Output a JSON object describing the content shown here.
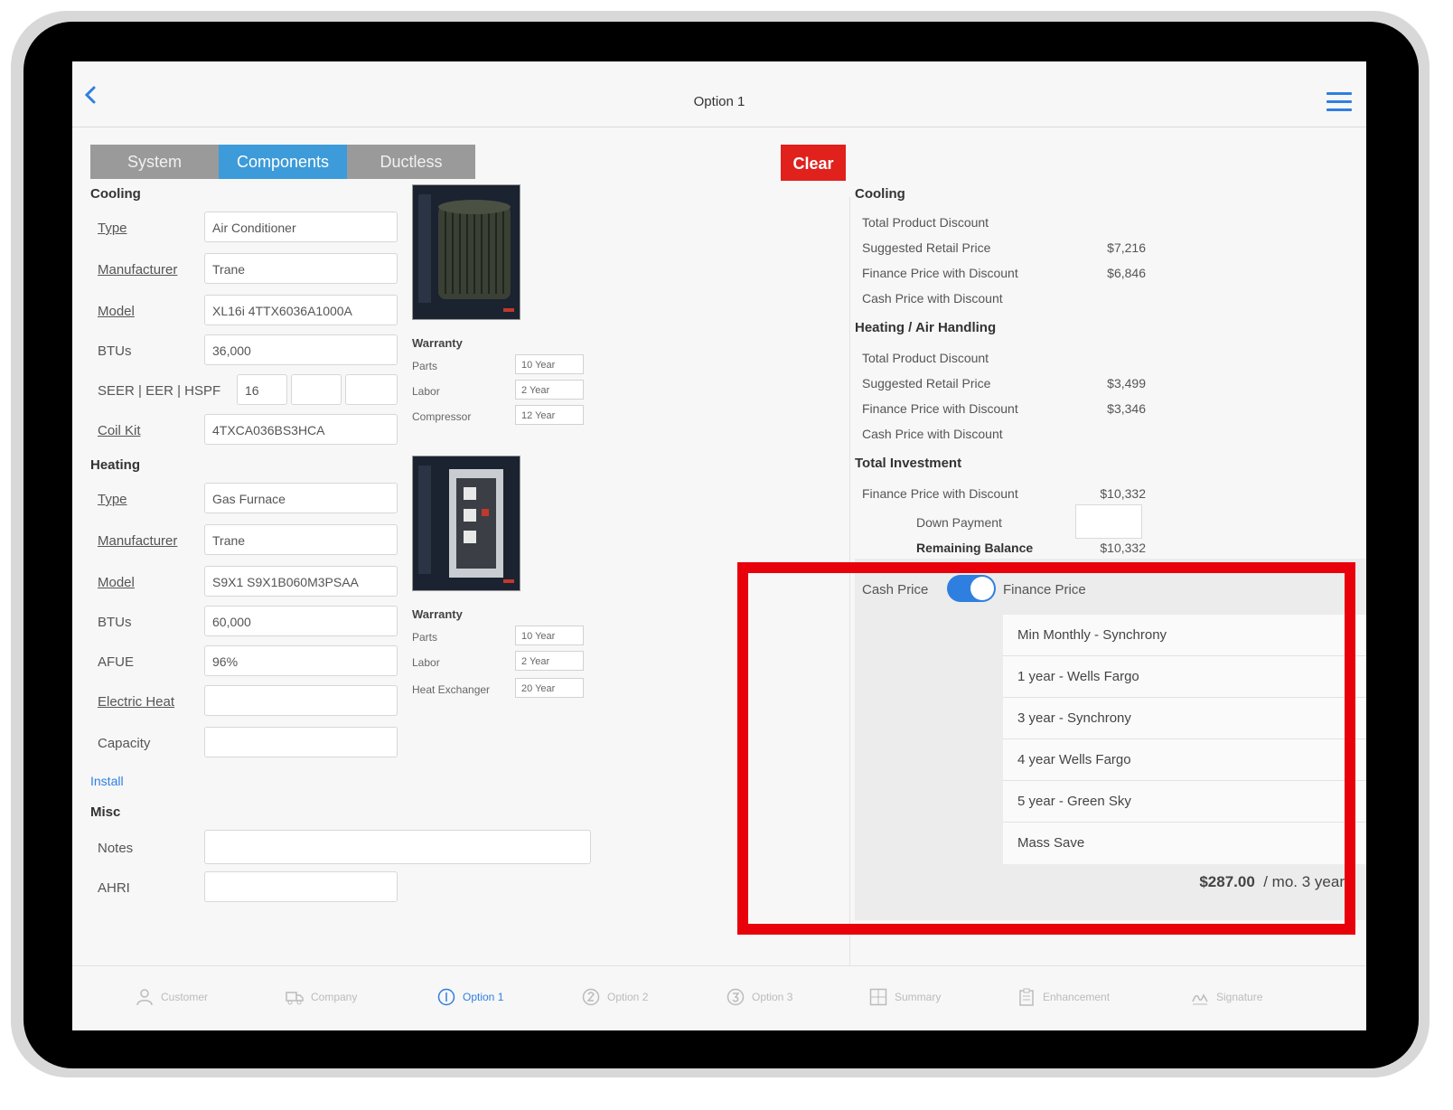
{
  "nav": {
    "title": "Option 1"
  },
  "segments": [
    {
      "label": "System",
      "active": false
    },
    {
      "label": "Components",
      "active": true
    },
    {
      "label": "Ductless",
      "active": false
    }
  ],
  "clear_label": "Clear",
  "cooling": {
    "heading": "Cooling",
    "type_label": "Type",
    "type_value": "Air Conditioner",
    "manufacturer_label": "Manufacturer",
    "manufacturer_value": "Trane",
    "model_label": "Model",
    "model_value": "XL16i 4TTX6036A1000A",
    "btus_label": "BTUs",
    "btus_value": "36,000",
    "seer_label": "SEER | EER | HSPF",
    "seer_value": "16",
    "eer_value": "",
    "hspf_value": "",
    "coil_label": "Coil Kit",
    "coil_value": "4TXCA036BS3HCA"
  },
  "heating": {
    "heading": "Heating",
    "type_label": "Type",
    "type_value": "Gas Furnace",
    "manufacturer_label": "Manufacturer",
    "manufacturer_value": "Trane",
    "model_label": "Model",
    "model_value": "S9X1 S9X1B060M3PSAA",
    "btus_label": "BTUs",
    "btus_value": "60,000",
    "afue_label": "AFUE",
    "afue_value": "96%",
    "electric_label": "Electric Heat",
    "electric_value": "",
    "capacity_label": "Capacity",
    "capacity_value": ""
  },
  "install_link": "Install",
  "misc": {
    "heading": "Misc",
    "notes_label": "Notes",
    "notes_value": "",
    "ahri_label": "AHRI",
    "ahri_value": ""
  },
  "cooling_warranty": {
    "heading": "Warranty",
    "rows": [
      {
        "label": "Parts",
        "value": "10 Year"
      },
      {
        "label": "Labor",
        "value": "2 Year"
      },
      {
        "label": "Compressor",
        "value": "12 Year"
      }
    ]
  },
  "heating_warranty": {
    "heading": "Warranty",
    "rows": [
      {
        "label": "Parts",
        "value": "10 Year"
      },
      {
        "label": "Labor",
        "value": "2 Year"
      },
      {
        "label": "Heat Exchanger",
        "value": "20 Year"
      }
    ]
  },
  "summary": {
    "cooling_heading": "Cooling",
    "cooling_rows": [
      {
        "label": "Total Product Discount",
        "value": ""
      },
      {
        "label": "Suggested Retail Price",
        "value": "$7,216"
      },
      {
        "label": "Finance Price with Discount",
        "value": "$6,846"
      },
      {
        "label": "Cash Price with Discount",
        "value": ""
      }
    ],
    "heating_heading": "Heating / Air Handling",
    "heating_rows": [
      {
        "label": "Total Product Discount",
        "value": ""
      },
      {
        "label": "Suggested Retail Price",
        "value": "$3,499"
      },
      {
        "label": "Finance Price with Discount",
        "value": "$3,346"
      },
      {
        "label": "Cash Price with Discount",
        "value": ""
      }
    ],
    "total_heading": "Total Investment",
    "total_finance_label": "Finance Price with Discount",
    "total_finance_value": "$10,332",
    "down_payment_label": "Down Payment",
    "remaining_label": "Remaining Balance",
    "remaining_value": "$10,332"
  },
  "finance": {
    "cash_label": "Cash Price",
    "finance_label": "Finance Price",
    "toggle_on": true,
    "plans": [
      {
        "label": "Min Monthly - Synchrony",
        "selected": false
      },
      {
        "label": "1 year - Wells Fargo",
        "selected": false
      },
      {
        "label": "3 year - Synchrony",
        "selected": true
      },
      {
        "label": "4 year Wells Fargo",
        "selected": false
      },
      {
        "label": "5 year - Green Sky",
        "selected": false
      },
      {
        "label": "Mass Save",
        "selected": false
      }
    ],
    "check_glyph": "✓",
    "monthly_amount": "$287.00",
    "monthly_suffix": "/ mo. 3 year"
  },
  "tabs": [
    {
      "label": "Customer",
      "icon": "person-icon",
      "active": false
    },
    {
      "label": "Company",
      "icon": "truck-icon",
      "active": false
    },
    {
      "label": "Option 1",
      "icon": "option1-icon",
      "active": true
    },
    {
      "label": "Option 2",
      "icon": "option2-icon",
      "active": false
    },
    {
      "label": "Option 3",
      "icon": "option3-icon",
      "active": false
    },
    {
      "label": "Summary",
      "icon": "grid-icon",
      "active": false
    },
    {
      "label": "Enhancement",
      "icon": "clipboard-icon",
      "active": false
    },
    {
      "label": "Signature",
      "icon": "signature-icon",
      "active": false
    }
  ],
  "colors": {
    "accent": "#2f7fe0",
    "segment_active": "#3d9bd9",
    "clear": "#e0211c",
    "highlight": "#e8000a"
  }
}
